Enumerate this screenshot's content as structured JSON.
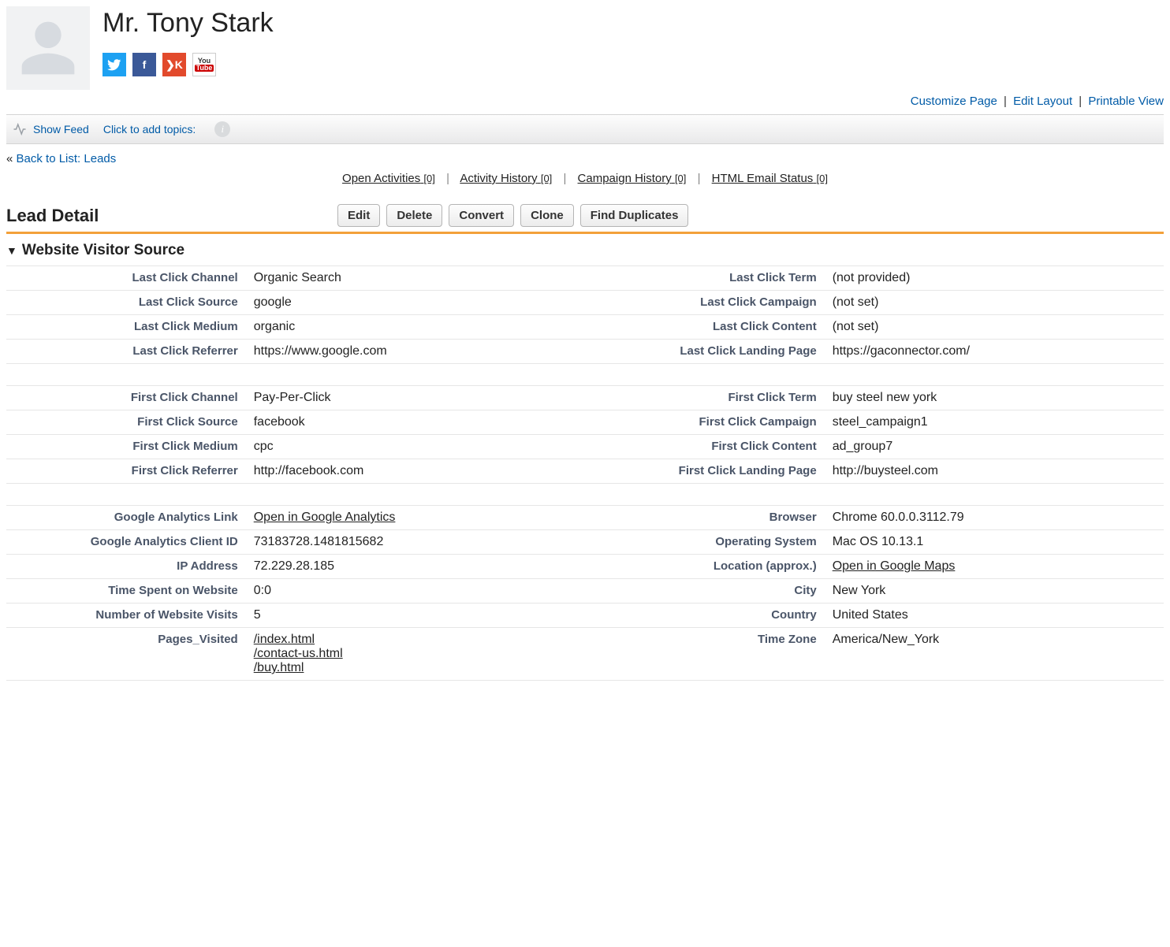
{
  "lead": {
    "name": "Mr. Tony Stark"
  },
  "social": {
    "twitter": "t",
    "facebook": "f",
    "klout": "❯K",
    "youtube_top": "You",
    "youtube_bottom": "Tube"
  },
  "page_actions": {
    "customize": "Customize Page",
    "edit_layout": "Edit Layout",
    "printable": "Printable View"
  },
  "toolbar": {
    "show_feed": "Show Feed",
    "add_topics": "Click to add topics:"
  },
  "back_link": {
    "prefix": "« ",
    "label": "Back to List: Leads"
  },
  "related": {
    "open_activities": {
      "label": "Open Activities",
      "count": "[0]"
    },
    "activity_history": {
      "label": "Activity History",
      "count": "[0]"
    },
    "campaign_history": {
      "label": "Campaign History",
      "count": "[0]"
    },
    "email_status": {
      "label": "HTML Email Status",
      "count": "[0]"
    }
  },
  "detail": {
    "title": "Lead Detail",
    "buttons": {
      "edit": "Edit",
      "delete": "Delete",
      "convert": "Convert",
      "clone": "Clone",
      "find_dup": "Find Duplicates"
    }
  },
  "section": {
    "title": "Website Visitor Source"
  },
  "fields": {
    "last_click_channel": {
      "label": "Last Click Channel",
      "value": "Organic Search"
    },
    "last_click_term": {
      "label": "Last Click Term",
      "value": "(not provided)"
    },
    "last_click_source": {
      "label": "Last Click Source",
      "value": "google"
    },
    "last_click_campaign": {
      "label": "Last Click Campaign",
      "value": "(not set)"
    },
    "last_click_medium": {
      "label": "Last Click Medium",
      "value": "organic"
    },
    "last_click_content": {
      "label": "Last Click Content",
      "value": "(not set)"
    },
    "last_click_referrer": {
      "label": "Last Click Referrer",
      "value": "https://www.google.com"
    },
    "last_click_landing": {
      "label": "Last Click Landing Page",
      "value": "https://gaconnector.com/"
    },
    "first_click_channel": {
      "label": "First Click Channel",
      "value": "Pay-Per-Click"
    },
    "first_click_term": {
      "label": "First Click Term",
      "value": "buy steel new york"
    },
    "first_click_source": {
      "label": "First Click Source",
      "value": "facebook"
    },
    "first_click_campaign": {
      "label": "First Click Campaign",
      "value": "steel_campaign1"
    },
    "first_click_medium": {
      "label": "First Click Medium",
      "value": "cpc"
    },
    "first_click_content": {
      "label": "First Click Content",
      "value": "ad_group7"
    },
    "first_click_referrer": {
      "label": "First Click Referrer",
      "value": "http://facebook.com"
    },
    "first_click_landing": {
      "label": "First Click Landing Page",
      "value": "http://buysteel.com"
    },
    "ga_link": {
      "label": "Google Analytics Link",
      "value": "Open in Google Analytics"
    },
    "browser": {
      "label": "Browser",
      "value": "Chrome 60.0.0.3112.79"
    },
    "ga_client_id": {
      "label": "Google Analytics Client ID",
      "value": "73183728.1481815682"
    },
    "os": {
      "label": "Operating System",
      "value": "Mac OS 10.13.1"
    },
    "ip": {
      "label": "IP Address",
      "value": "72.229.28.185"
    },
    "location": {
      "label": "Location (approx.)",
      "value": "Open in Google Maps"
    },
    "time_spent": {
      "label": "Time Spent on Website",
      "value": "0:0"
    },
    "city": {
      "label": "City",
      "value": "New York"
    },
    "visits": {
      "label": "Number of Website Visits",
      "value": "5"
    },
    "country": {
      "label": "Country",
      "value": "United States"
    },
    "pages_visited": {
      "label": "Pages_Visited",
      "p1": "/index.html",
      "p2": "/contact-us.html",
      "p3": "/buy.html"
    },
    "timezone": {
      "label": "Time Zone",
      "value": "America/New_York"
    }
  }
}
